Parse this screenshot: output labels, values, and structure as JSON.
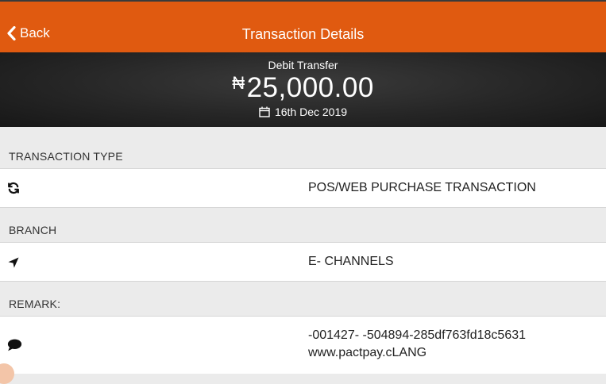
{
  "header": {
    "back_label": "Back",
    "title": "Transaction Details"
  },
  "summary": {
    "type": "Debit Transfer",
    "currency_symbol": "₦",
    "amount": "25,000.00",
    "date": "16th Dec 2019"
  },
  "details": [
    {
      "label": "TRANSACTION TYPE",
      "icon": "refresh-icon",
      "value": "POS/WEB PURCHASE TRANSACTION"
    },
    {
      "label": "BRANCH",
      "icon": "location-arrow-icon",
      "value": "E- CHANNELS"
    },
    {
      "label": "REMARK:",
      "icon": "comment-icon",
      "value_lines": [
        "-001427- -504894-285df763fd18c5631",
        "www.pactpay.cLANG"
      ]
    }
  ]
}
